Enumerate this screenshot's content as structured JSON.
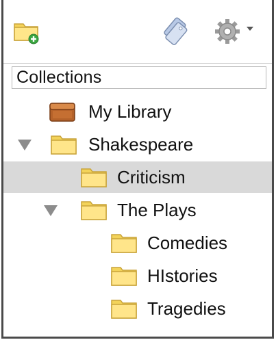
{
  "toolbar": {
    "buttons": [
      {
        "name": "new-collection",
        "icon": "folder-add-icon"
      },
      {
        "name": "tag-selector",
        "icon": "tag-selector-icon"
      },
      {
        "name": "actions-menu",
        "icon": "gear-icon"
      }
    ]
  },
  "header": {
    "title": "Collections"
  },
  "tree": {
    "items": [
      {
        "label": "My Library",
        "icon": "library-icon",
        "level": 0,
        "expanded": null,
        "selected": false
      },
      {
        "label": "Shakespeare",
        "icon": "folder-icon",
        "level": 0,
        "expanded": true,
        "selected": false
      },
      {
        "label": "Criticism",
        "icon": "folder-icon",
        "level": 1,
        "expanded": null,
        "selected": true
      },
      {
        "label": "The Plays",
        "icon": "folder-icon",
        "level": 1,
        "expanded": true,
        "selected": false
      },
      {
        "label": "Comedies",
        "icon": "folder-icon",
        "level": 2,
        "expanded": null,
        "selected": false
      },
      {
        "label": "HIstories",
        "icon": "folder-icon",
        "level": 2,
        "expanded": null,
        "selected": false
      },
      {
        "label": "Tragedies",
        "icon": "folder-icon",
        "level": 2,
        "expanded": null,
        "selected": false
      }
    ]
  },
  "colors": {
    "selection": "#d9d9d9",
    "folder": "#f3d35a",
    "library": "#a0522d",
    "twisty": "#8c8c8c"
  }
}
